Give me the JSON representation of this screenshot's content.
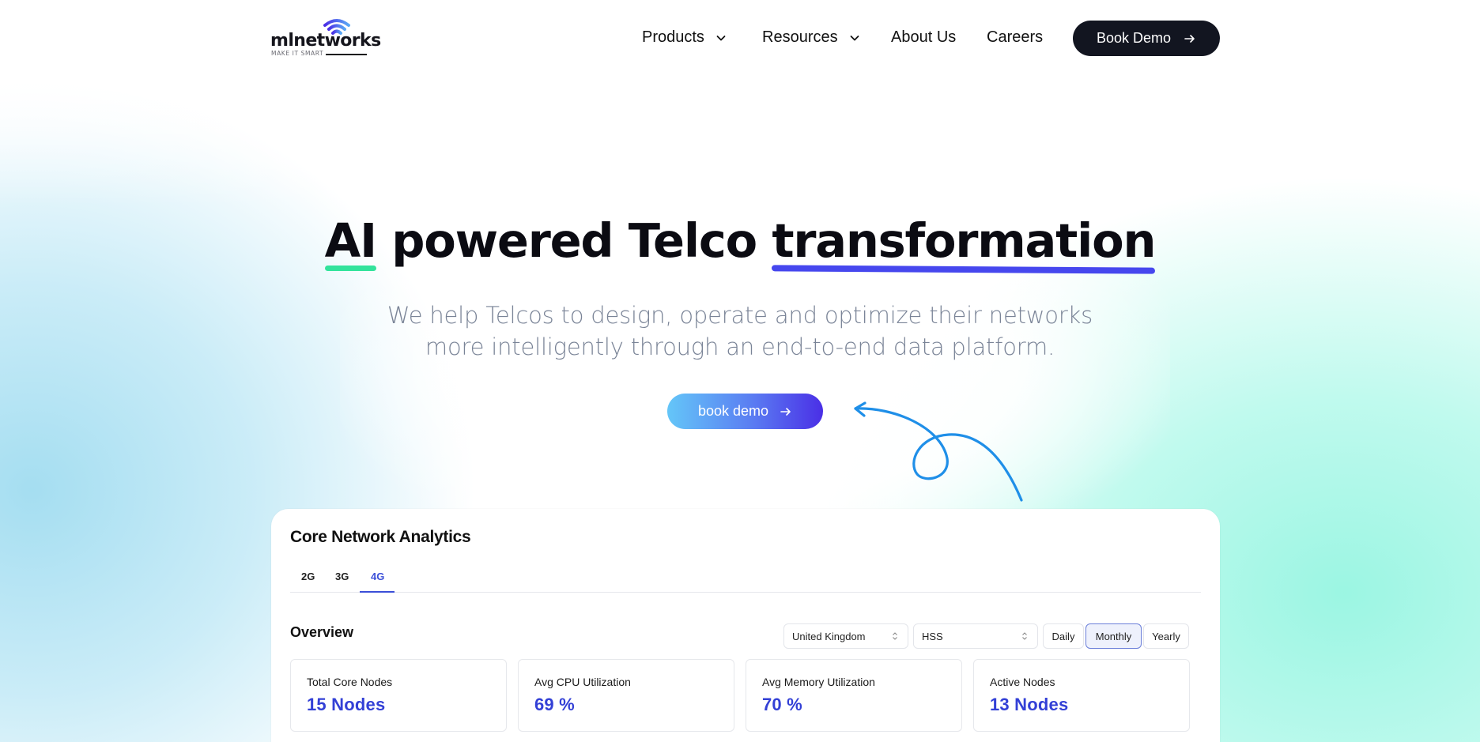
{
  "brand": {
    "name": "mlnetworks",
    "tagline": "MAKE IT SMART",
    "colors": {
      "dark": "#121520",
      "accent_blue": "#4647ee",
      "accent_green": "#33e39c",
      "stat_blue": "#3340d6"
    }
  },
  "nav": {
    "items": [
      {
        "label": "Products",
        "has_dropdown": true,
        "icon": "chevron-down-icon"
      },
      {
        "label": "Resources",
        "has_dropdown": true,
        "icon": "chevron-down-icon"
      },
      {
        "label": "About Us",
        "has_dropdown": false
      },
      {
        "label": "Careers",
        "has_dropdown": false
      }
    ],
    "cta_label": "Book Demo",
    "cta_icon": "arrow-right-icon"
  },
  "hero": {
    "title_part1": "AI",
    "title_part2": " powered Telco ",
    "title_part3": "transformation",
    "subtitle_line1": "We help Telcos to design, operate and optimize their networks",
    "subtitle_line2": "more intelligently through an end-to-end data platform.",
    "cta_label": "book demo",
    "cta_icon": "arrow-right-icon"
  },
  "dashboard": {
    "title": "Core Network Analytics",
    "tabs": [
      {
        "label": "2G",
        "active": false
      },
      {
        "label": "3G",
        "active": false
      },
      {
        "label": "4G",
        "active": true
      }
    ],
    "overview_title": "Overview",
    "country_select": "United Kingdom",
    "node_select": "HSS",
    "periods": [
      {
        "label": "Daily",
        "active": false
      },
      {
        "label": "Monthly",
        "active": true
      },
      {
        "label": "Yearly",
        "active": false
      }
    ],
    "stats": [
      {
        "label": "Total Core Nodes",
        "value": "15 Nodes"
      },
      {
        "label": "Avg CPU Utilization",
        "value": "69 %"
      },
      {
        "label": "Avg Memory Utilization",
        "value": "70 %"
      },
      {
        "label": "Active Nodes",
        "value": "13 Nodes"
      }
    ]
  }
}
